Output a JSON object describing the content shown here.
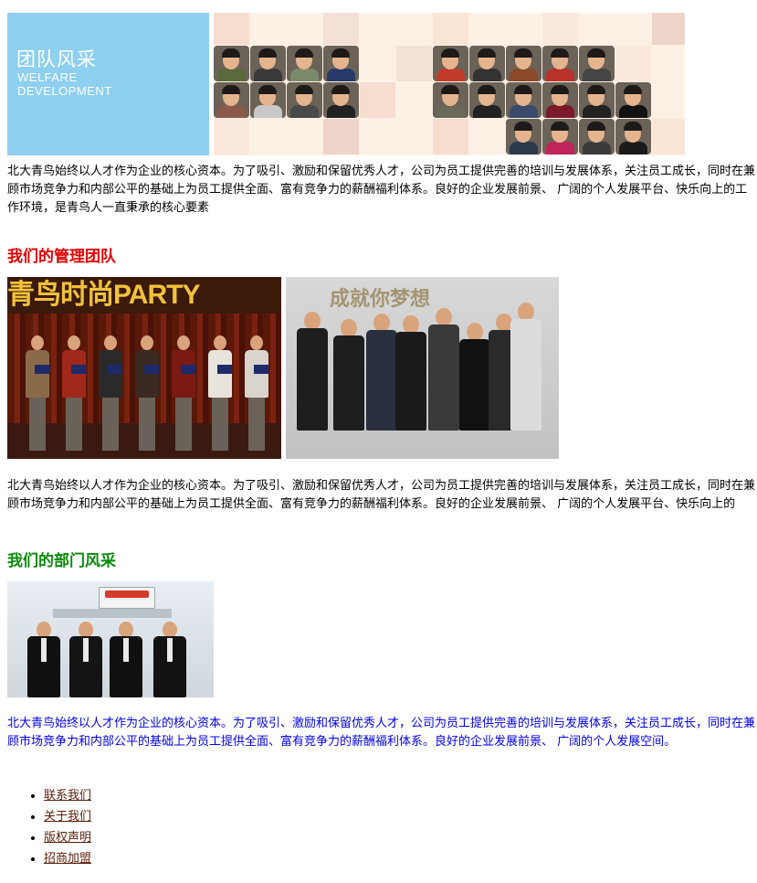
{
  "banner": {
    "title": "团队风采",
    "subtitle_line1": "WELFARE",
    "subtitle_line2": "DEVELOPMENT",
    "accent_color": "#8fcff0"
  },
  "intro_paragraph": "北大青鸟始终以人才作为企业的核心资本。为了吸引、激励和保留优秀人才，公司为员工提供完善的培训与发展体系，关注员工成长，同时在兼顾市场竞争力和内部公平的基础上为员工提供全面、富有竞争力的薪酬福利体系。良好的企业发展前景、 广阔的个人发展平台、快乐向上的工作环境，是青鸟人一直秉承的核心要素",
  "management": {
    "heading": "我们的管理团队",
    "heading_color": "#e00000",
    "party_banner_text": "青鸟时尚PARTY",
    "office_wall_text": "成就你梦想",
    "paragraph": "北大青鸟始终以人才作为企业的核心资本。为了吸引、激励和保留优秀人才，公司为员工提供完善的培训与发展体系，关注员工成长，同时在兼顾市场竞争力和内部公平的基础上为员工提供全面、富有竞争力的薪酬福利体系。良好的企业发展前景、 广阔的个人发展平台、快乐向上的"
  },
  "department": {
    "heading": "我们的部门风采",
    "heading_color": "#0a8a0a",
    "paragraph": "北大青鸟始终以人才作为企业的核心资本。为了吸引、激励和保留优秀人才，公司为员工提供完善的培训与发展体系，关注员工成长，同时在兼顾市场竞争力和内部公平的基础上为员工提供全面、富有竞争力的薪酬福利体系。良好的企业发展前景、 广阔的个人发展空间。",
    "paragraph_color": "#0000ee"
  },
  "footer_links": [
    {
      "label": "联系我们"
    },
    {
      "label": "关于我们"
    },
    {
      "label": "版权声明"
    },
    {
      "label": "招商加盟"
    }
  ]
}
